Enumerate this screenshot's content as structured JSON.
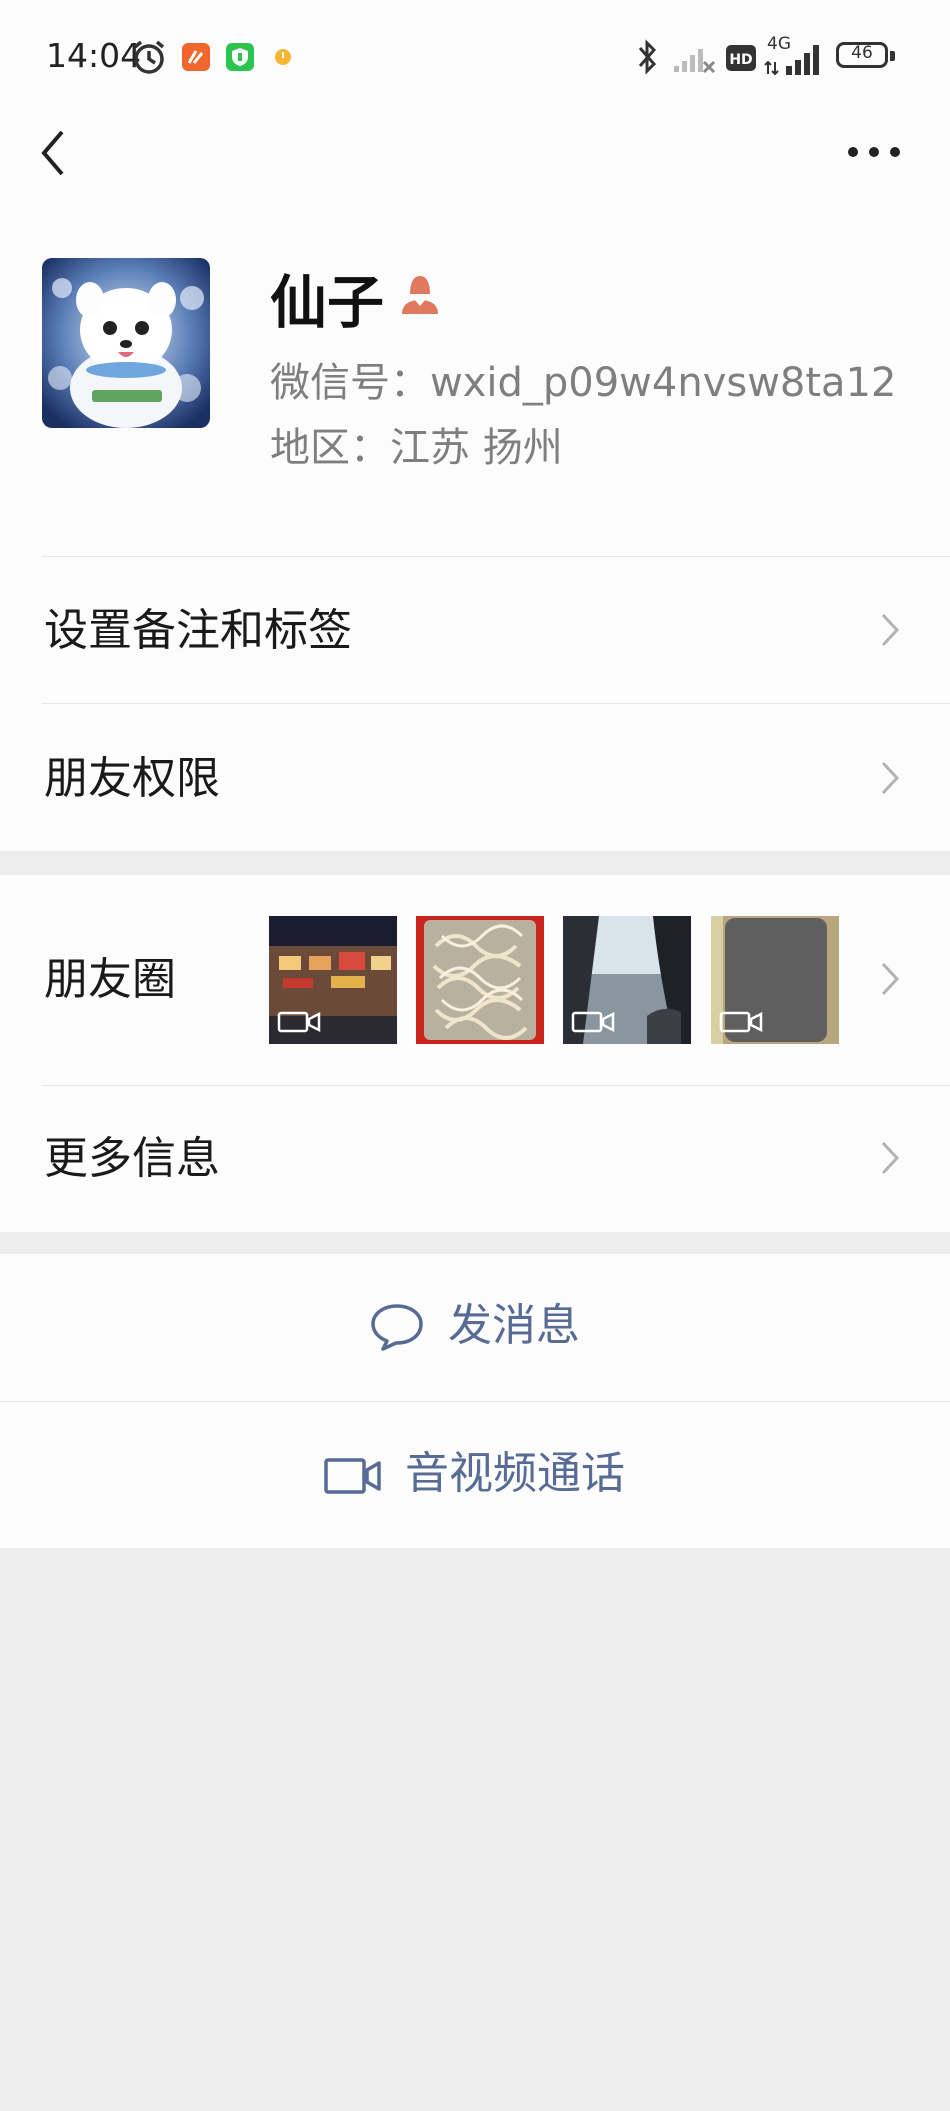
{
  "status_bar": {
    "time": "14:04",
    "battery": "46",
    "network": "4G",
    "hd": "HD",
    "icons": [
      "alarm-icon",
      "app-orange-icon",
      "app-green-shield-icon",
      "notification-dot-icon",
      "bluetooth-icon",
      "signal-sim2-icon",
      "hd-icon",
      "signal-4g-icon",
      "battery-icon"
    ]
  },
  "nav": {
    "back_icon": "chevron-left-icon",
    "more_icon": "more-dots-icon"
  },
  "profile": {
    "name": "仙子",
    "gender_icon": "female-person-icon",
    "wechat_id": "微信号：wxid_p09w4nvsw8ta12",
    "region": "地区：江苏  扬州"
  },
  "menu": {
    "remark_tags": "设置备注和标签",
    "friend_permissions": "朋友权限",
    "moments": "朋友圈",
    "more_info": "更多信息"
  },
  "moments_thumbs": [
    {
      "desc": "night-street-photo",
      "is_video": true
    },
    {
      "desc": "noodles-photo",
      "is_video": false
    },
    {
      "desc": "car-window-photo",
      "is_video": true
    },
    {
      "desc": "gray-box-photo",
      "is_video": true
    }
  ],
  "actions": {
    "send_message": "发消息",
    "video_call": "音视频通话"
  },
  "colors": {
    "link_blue": "#576b95",
    "gender_female": "#e07a5f",
    "background_gray": "#ededed"
  }
}
